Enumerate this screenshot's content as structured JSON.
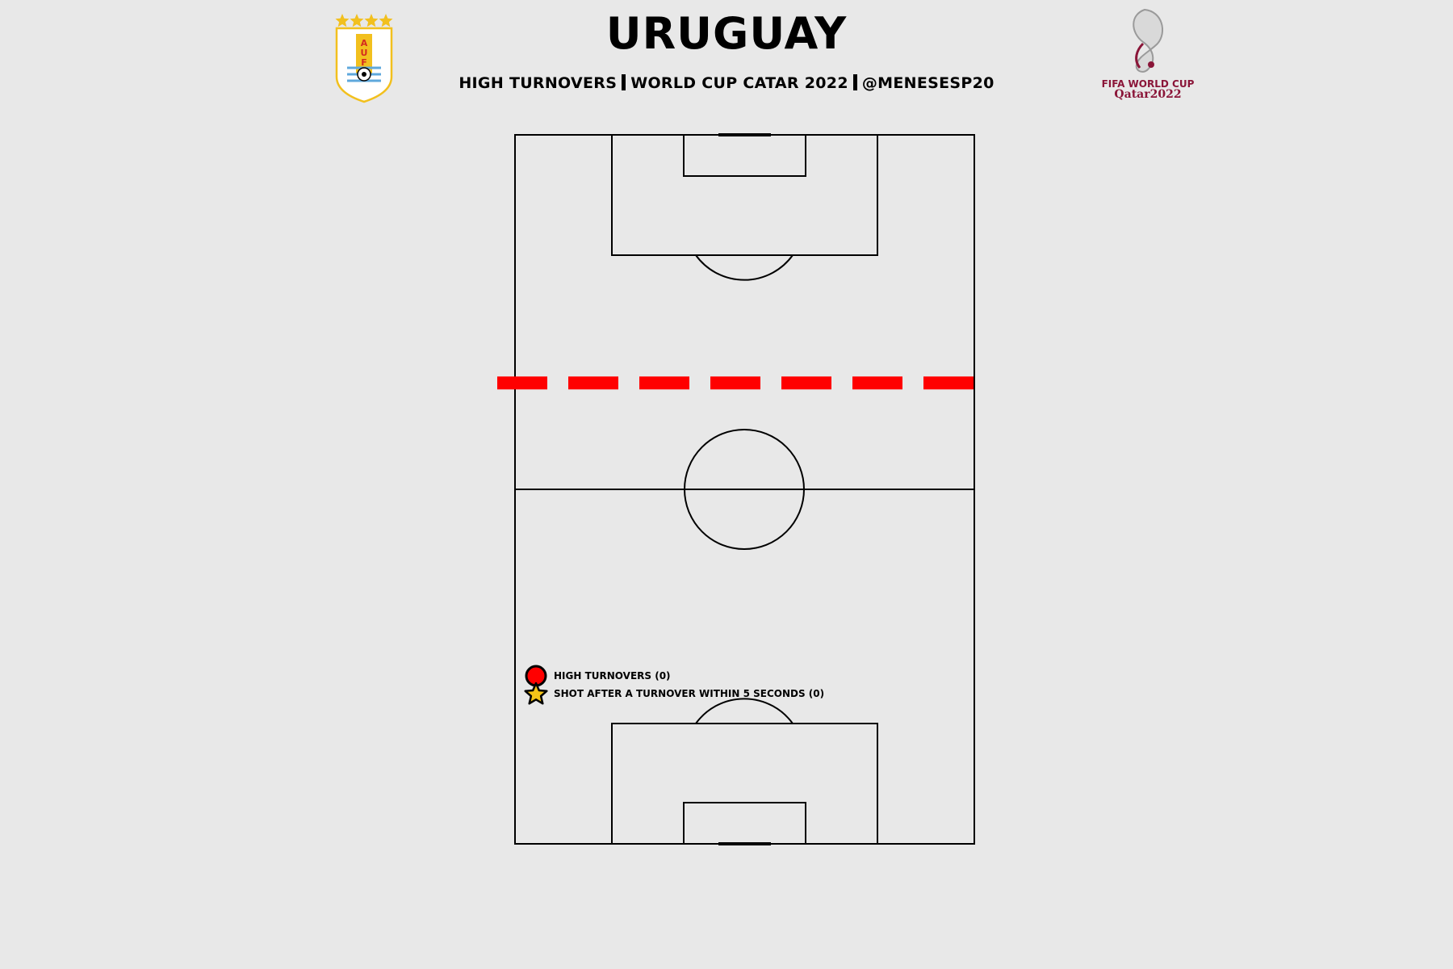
{
  "title": "URUGUAY",
  "subtitle": {
    "part1": "HIGH TURNOVERS",
    "part2": "WORLD CUP CATAR 2022",
    "part3": "@MENESESP20"
  },
  "logos": {
    "left": {
      "letters": [
        "A",
        "U",
        "F"
      ],
      "stars": 4
    },
    "right": {
      "line1": "FIFA WORLD CUP",
      "line2": "Qatar2022"
    }
  },
  "colors": {
    "background": "#e8e8e8",
    "line": "#000000",
    "threshold": "#ff0000",
    "turnover_marker": "#ff0000",
    "shot_marker": "#f5c518",
    "auf_gold": "#f2c01e",
    "auf_blue": "#5fa8dc",
    "qatar_maroon": "#8a1538"
  },
  "chart_data": {
    "type": "scatter",
    "series": [
      {
        "name": "HIGH TURNOVERS (0)",
        "marker": "circle",
        "points": []
      },
      {
        "name": "SHOT AFTER A TURNOVER WITHIN 5 SECONDS (0)",
        "marker": "star",
        "points": []
      }
    ],
    "legend": {
      "items": [
        "HIGH TURNOVERS (0)",
        "SHOT AFTER A TURNOVER WITHIN 5 SECONDS (0)"
      ],
      "placement": "bottom-left"
    },
    "threshold_line_fraction": 0.35
  }
}
